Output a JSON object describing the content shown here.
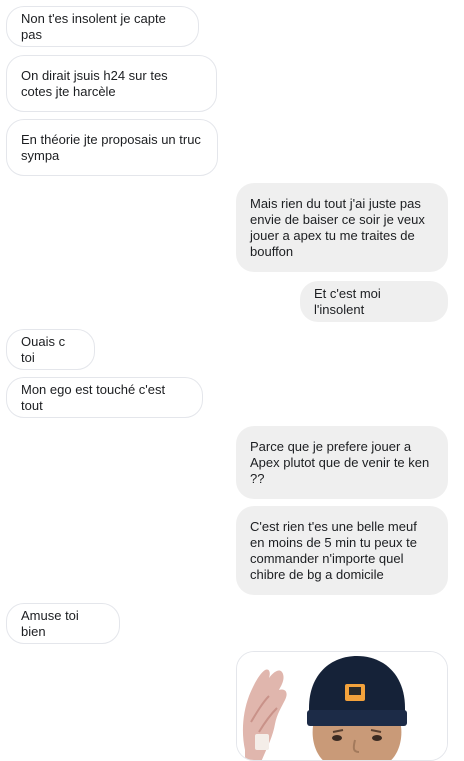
{
  "messages": [
    {
      "side": "received",
      "text": "Non t'es insolent je capte pas"
    },
    {
      "side": "received",
      "text": "On dirait jsuis h24 sur tes cotes jte harcèle"
    },
    {
      "side": "received",
      "text": "En théorie jte proposais un truc sympa"
    },
    {
      "side": "sent",
      "text": "Mais rien du tout j'ai juste pas envie de baiser ce soir je veux jouer a apex tu me traites de bouffon"
    },
    {
      "side": "sent",
      "text": "Et c'est moi l'insolent"
    },
    {
      "side": "received",
      "text": "Ouais c toi"
    },
    {
      "side": "received",
      "text": "Mon ego est touché c'est tout"
    },
    {
      "side": "sent",
      "text": "Parce que je prefere jouer a Apex plutot que de venir te ken ??"
    },
    {
      "side": "sent",
      "text": "C'est rien t'es une belle meuf en moins de 5 min tu peux te commander n'importe quel chibre de bg a domicile"
    },
    {
      "side": "received",
      "text": "Amuse toi bien"
    }
  ],
  "attachment": {
    "type": "image",
    "icon": "photo-meme-icon"
  },
  "colors": {
    "received_bg": "#ffffff",
    "received_border": "#e4e6eb",
    "sent_bg": "#efefef",
    "text": "#1c1e21"
  }
}
